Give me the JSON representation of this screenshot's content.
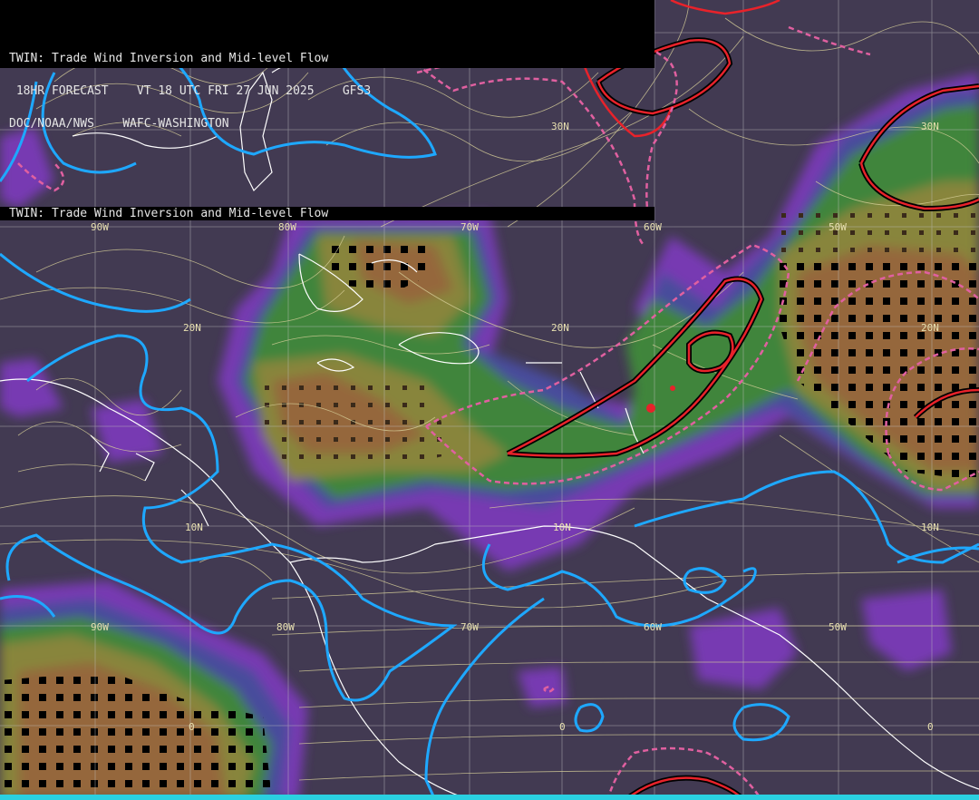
{
  "header": {
    "title": "TWIN: Trade Wind Inversion and Mid-level Flow",
    "forecast_line": " 18HR FORECAST    VT 18 UTC FRI 27 JUN 2025    GFS3",
    "agency_line": "DOC/NOAA/NWS    WAFC-WASHINGTON"
  },
  "second_title": "TWIN: Trade Wind Inversion and Mid-level Flow",
  "grid_labels": {
    "lat_30n_a": "30N",
    "lat_30n_b": "30N",
    "lat_20n_a": "20N",
    "lat_20n_b": "20N",
    "lat_20n_c": "20N",
    "lat_10n_a": "10N",
    "lat_10n_b": "10N",
    "lat_10n_c": "10N",
    "lon_90w_a": "90W",
    "lon_80w_a": "80W",
    "lon_70w_a": "70W",
    "lon_60w_a": "60W",
    "lon_50w_a": "50W",
    "lon_90w_b": "90W",
    "lon_80w_b": "80W",
    "lon_70w_b": "70W",
    "lon_60w_b": "60W",
    "lon_50w_b": "50W",
    "eq_a": "0",
    "eq_b": "0",
    "eq_c": "0"
  },
  "colors": {
    "background": "#423a52",
    "shade_purple": "#7a3ab8",
    "shade_blue": "#4a4ea0",
    "shade_green": "#3f8a3a",
    "shade_olive": "#8c8a3a",
    "shade_brown": "#9a6a3a",
    "contour_cyan": "#1ea8ff",
    "contour_red": "#e8222a",
    "contour_pink": "#e060a0",
    "streamline": "#d8d09a",
    "coast": "#ffffff",
    "grid": "#bfbfbf"
  }
}
